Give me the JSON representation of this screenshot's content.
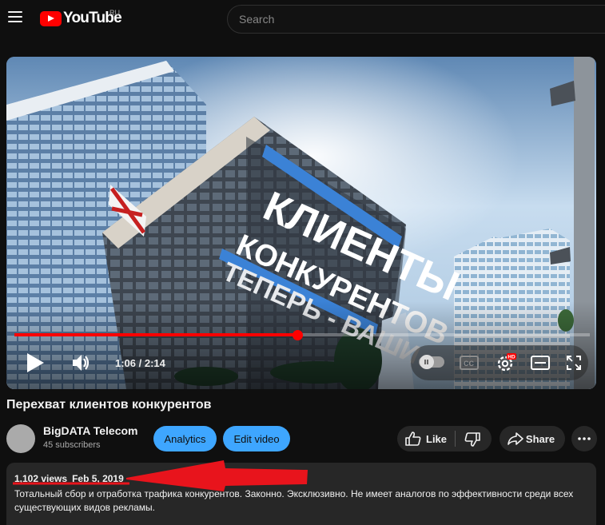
{
  "header": {
    "logo_text": "YouTube",
    "region": "RU",
    "search_placeholder": "Search"
  },
  "player": {
    "overlay_lines": [
      "КЛИЕНТЫ",
      "КОНКУРЕНТОВ",
      "ТЕПЕРЬ - ВАШИ"
    ],
    "time_display": "1:06 / 2:14",
    "progress_fraction": 0.492,
    "quality_badge": "HD"
  },
  "video": {
    "title": "Перехват клиентов конкурентов",
    "channel_name": "BigDATA Telecom",
    "subscribers": "45 subscribers",
    "analytics_label": "Analytics",
    "edit_label": "Edit video",
    "like_label": "Like",
    "share_label": "Share"
  },
  "description": {
    "views": "1,102 views",
    "date": "Feb 5, 2019",
    "text": "Тотальный сбор и отработка трафика конкурентов. Законно. Эксклюзивно. Не имеет аналогов по эффективности среди всех существующих видов рекламы."
  },
  "colors": {
    "accent_red": "#ff0000",
    "button_blue": "#3ea6ff",
    "annotation_red": "#e8141c"
  }
}
